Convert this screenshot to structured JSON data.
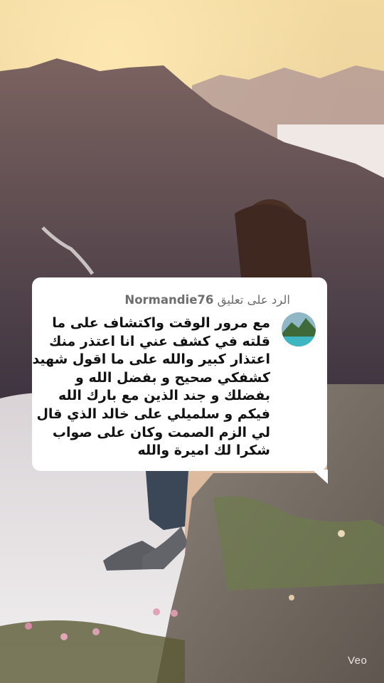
{
  "comment_reply": {
    "prefix": "الرد على تعليق",
    "username": "Normandie76",
    "text": "مع مرور الوقت واكتشاف على ما قلته في كشف عني انا اعتذر منك اعتذار كبير والله على ما اقول شهيد كشفكي صحيح و بفضل الله و بفضلك و جند الذين مع بارك الله فيكم و سلميلي على خالد الذي قال لي الزم الصمت وكان على صواب شكرا لك اميرة والله",
    "avatar_icon": "landscape-avatar-icon"
  },
  "watermark": "Veo",
  "colors": {
    "card_bg": "#ffffff",
    "header_text": "#6e6e6e",
    "body_text": "#111111",
    "sky_top": "#f7cf8e",
    "mountain": "#5a4a54"
  }
}
